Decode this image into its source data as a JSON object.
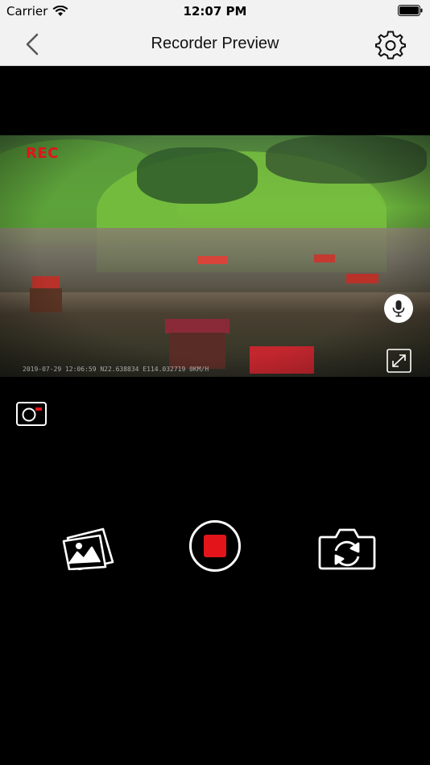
{
  "status_bar": {
    "carrier": "Carrier",
    "time": "12:07 PM",
    "icons": [
      "wifi-icon",
      "battery-icon"
    ]
  },
  "nav": {
    "title": "Recorder Preview",
    "back_icon": "chevron-left-icon",
    "settings_icon": "gear-icon"
  },
  "video": {
    "rec_label": "REC",
    "overlay_text": "2019-07-29 12:06:59     N22.638834 E114.032719 0KM/H",
    "mic_icon": "microphone-icon",
    "fullscreen_icon": "expand-icon"
  },
  "controls": {
    "snapshot_icon": "camera-snapshot-icon",
    "gallery_icon": "photo-gallery-icon",
    "record_icon": "stop-record-icon",
    "switch_camera_icon": "switch-camera-icon"
  },
  "colors": {
    "accent_red": "#e3151a",
    "nav_background": "#f2f2f2",
    "background": "#000000"
  }
}
